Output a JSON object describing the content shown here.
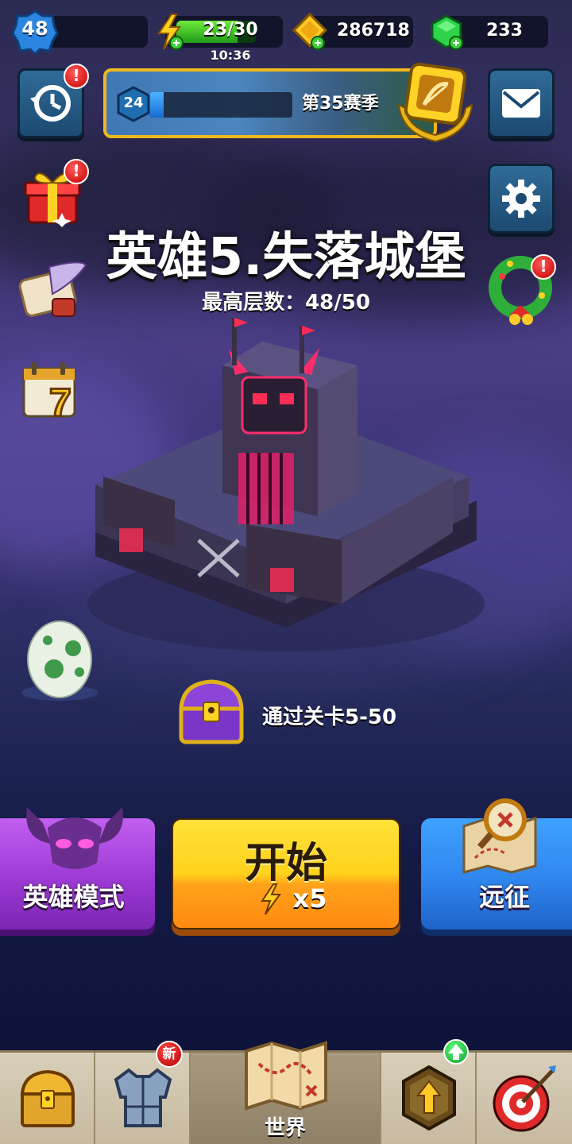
{
  "player": {
    "level": "48"
  },
  "energy": {
    "text": "23/30",
    "fraction": 0.77,
    "timer": "10:36"
  },
  "coins": {
    "value": "286718"
  },
  "gems": {
    "value": "233"
  },
  "season": {
    "level": "24",
    "progress": 0.1,
    "label": "第35赛季"
  },
  "alerts": {
    "mark": "!"
  },
  "chapter": {
    "title": "英雄5.失落城堡",
    "best_floor": "最高层数：48/50"
  },
  "reward": {
    "text": "通过关卡5-50"
  },
  "buttons": {
    "hero_mode": "英雄模式",
    "start": "开始",
    "start_cost": "x5",
    "expedition": "远征"
  },
  "nav": {
    "world_label": "世界",
    "new_badge": "新"
  },
  "colors": {
    "accent_gold": "#f1b81c",
    "start_button": "#ffd21c",
    "hero_button": "#9d39d4",
    "expedition_button": "#2f86ee",
    "alert_red": "#c40000"
  }
}
